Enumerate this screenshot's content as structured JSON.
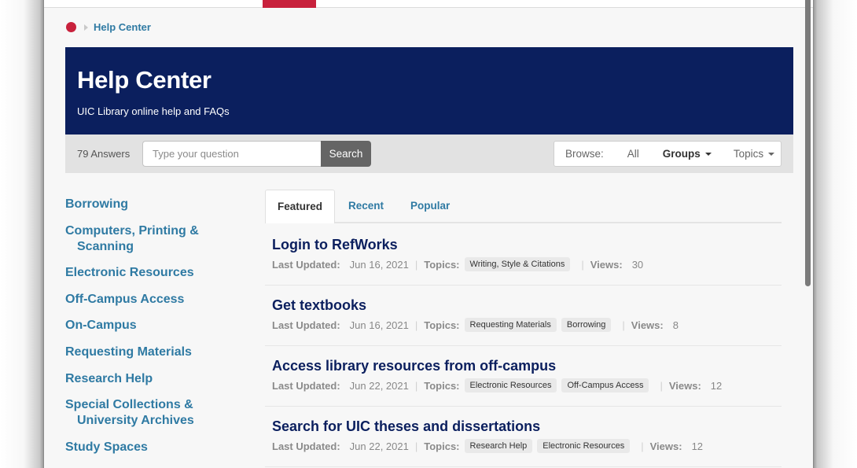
{
  "breadcrumb": {
    "home_icon": "home-dot-icon",
    "current": "Help Center"
  },
  "banner": {
    "title": "Help Center",
    "subtitle": "UIC Library online help and FAQs"
  },
  "search": {
    "answers_count": "79 Answers",
    "placeholder": "Type your question",
    "value": "",
    "button_label": "Search"
  },
  "browse": {
    "label": "Browse:",
    "all": "All",
    "groups": "Groups",
    "topics": "Topics"
  },
  "sidebar": {
    "items": [
      {
        "label": "Borrowing"
      },
      {
        "label": "Computers, Printing & Scanning"
      },
      {
        "label": "Electronic Resources"
      },
      {
        "label": "Off-Campus Access"
      },
      {
        "label": "On-Campus"
      },
      {
        "label": "Requesting Materials"
      },
      {
        "label": "Research Help"
      },
      {
        "label": "Special Collections & University Archives"
      },
      {
        "label": "Study Spaces"
      }
    ]
  },
  "tabs": [
    {
      "label": "Featured",
      "active": true
    },
    {
      "label": "Recent",
      "active": false
    },
    {
      "label": "Popular",
      "active": false
    }
  ],
  "labels": {
    "last_updated": "Last Updated:",
    "topics": "Topics:",
    "views": "Views:",
    "separator": "|"
  },
  "articles": [
    {
      "title": "Login to RefWorks",
      "last_updated": "Jun 16, 2021",
      "topics": [
        "Writing, Style & Citations"
      ],
      "views": "30"
    },
    {
      "title": "Get textbooks",
      "last_updated": "Jun 16, 2021",
      "topics": [
        "Requesting Materials",
        "Borrowing"
      ],
      "views": "8"
    },
    {
      "title": "Access library resources from off-campus",
      "last_updated": "Jun 22, 2021",
      "topics": [
        "Electronic Resources",
        "Off-Campus Access"
      ],
      "views": "12"
    },
    {
      "title": "Search for UIC theses and dissertations",
      "last_updated": "Jun 22, 2021",
      "topics": [
        "Research Help",
        "Electronic Resources"
      ],
      "views": "12"
    }
  ],
  "colors": {
    "brand_navy": "#0b1f5e",
    "brand_red": "#c8213c",
    "link_blue": "#2f7aa3"
  }
}
